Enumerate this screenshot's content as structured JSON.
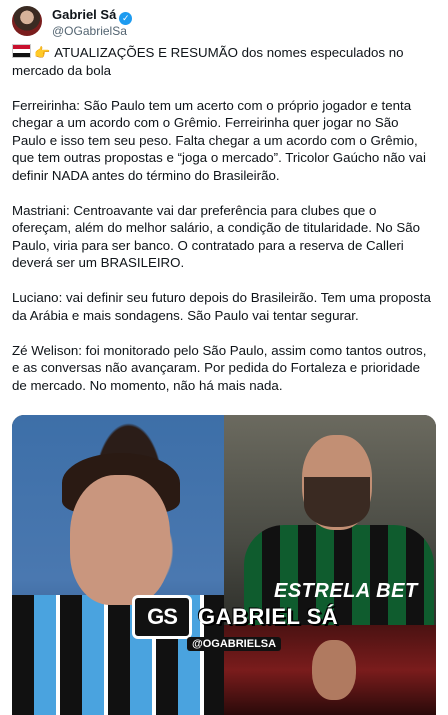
{
  "author": {
    "name": "Gabriel Sá",
    "handle": "@OGabrielSa",
    "verified": true
  },
  "tweet": {
    "intro": "ATUALIZAÇÕES E RESUMÃO dos nomes especulados no mercado da bola",
    "paragraphs": [
      "Ferreirinha: São Paulo tem um acerto com o próprio jogador e tenta chegar a um acordo com o Grêmio. Ferreirinha quer jogar no São Paulo e isso tem seu peso. Falta chegar a um acordo com o Grêmio, que tem outras propostas e “joga o mercado”. Tricolor Gaúcho não vai definir NADA antes do término do Brasileirão.",
      "Mastriani: Centroavante vai dar preferência para clubes que o ofereçam, além do melhor salário, a condição de titularidade. No São Paulo, viria para ser banco. O contratado para a reserva de Calleri deverá ser um BRASILEIRO.",
      "Luciano: vai definir seu futuro depois do Brasileirão. Tem uma proposta da Arábia e mais sondagens. São Paulo vai tentar segurar.",
      "Zé Welison: foi monitorado pelo São Paulo, assim como tantos outros, e as conversas não avançaram. Por pedida do Fortaleza e prioridade de mercado. No momento, não há mais nada."
    ]
  },
  "media": {
    "watermark": "GABRIEL SÁ",
    "watermark_badge": "GS",
    "watermark_handle": "@OGABRIELSA",
    "sponsor_text": "ESTRELA BET"
  },
  "colors": {
    "verified": "#1d9bf0",
    "text": "#0f1419",
    "secondary": "#536471"
  }
}
